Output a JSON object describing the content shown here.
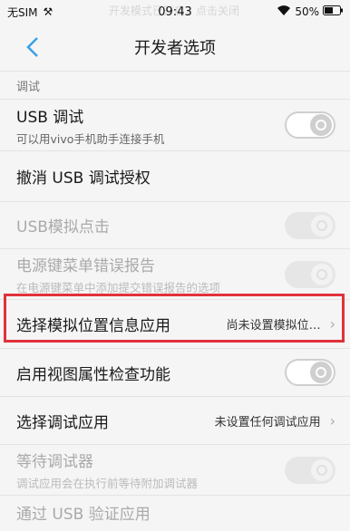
{
  "status": {
    "carrier": "无SIM",
    "time": "09:43",
    "battery": "50%",
    "banner_text": "开发模式已开启，点击关闭"
  },
  "header": {
    "title": "开发者选项"
  },
  "section": {
    "label": "调试"
  },
  "rows": [
    {
      "title": "USB 调试",
      "subtitle": "可以用vivo手机助手连接手机"
    },
    {
      "title": "撤消 USB 调试授权"
    },
    {
      "title": "USB模拟点击"
    },
    {
      "title": "电源键菜单错误报告",
      "subtitle": "在电源键菜单中添加提交错误报告的选项"
    },
    {
      "title": "选择模拟位置信息应用",
      "value": "尚未设置模拟位…"
    },
    {
      "title": "启用视图属性检查功能"
    },
    {
      "title": "选择调试应用",
      "value": "未设置任何调试应用"
    },
    {
      "title": "等待调试器",
      "subtitle": "调试应用会在执行前等待附加调试器"
    },
    {
      "title": "通过 USB 验证应用"
    }
  ]
}
